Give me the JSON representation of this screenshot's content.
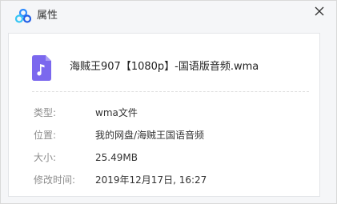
{
  "window": {
    "title": "属性",
    "logo_icon": "baidu-netdisk-logo-icon",
    "close_icon": "close-icon"
  },
  "file": {
    "icon": "music-note-icon",
    "icon_color": "#7b68ee",
    "name": "海贼王907【1080p】-国语版音频.wma"
  },
  "properties": [
    {
      "label": "类型:",
      "value": "wma文件"
    },
    {
      "label": "位置:",
      "value": "我的网盘/海贼王国语音频"
    },
    {
      "label": "大小:",
      "value": "25.49MB"
    },
    {
      "label": "修改时间:",
      "value": "2019年12月17日, 16:27"
    }
  ]
}
